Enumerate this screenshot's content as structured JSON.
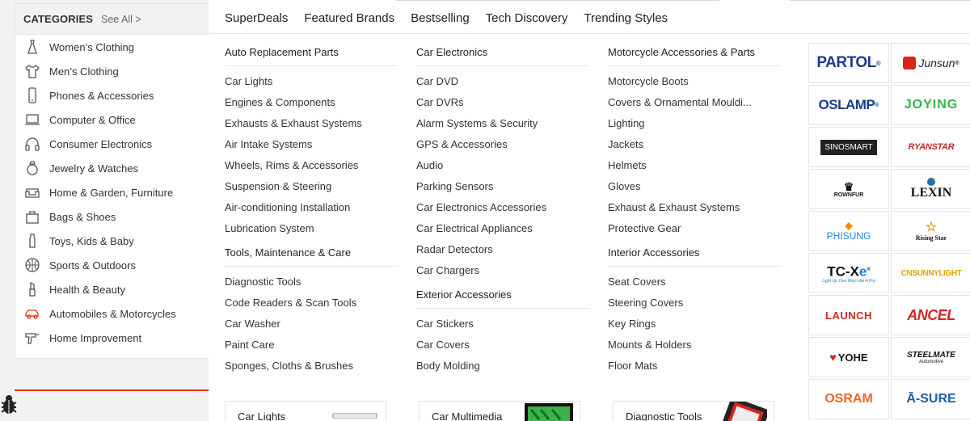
{
  "categories": {
    "title": "CATEGORIES",
    "see_all": "See All >",
    "items": [
      {
        "label": "Women’s Clothing",
        "icon": "dress-icon"
      },
      {
        "label": "Men’s Clothing",
        "icon": "shirt-icon"
      },
      {
        "label": "Phones & Accessories",
        "icon": "phone-icon"
      },
      {
        "label": "Computer & Office",
        "icon": "laptop-icon"
      },
      {
        "label": "Consumer Electronics",
        "icon": "headphones-icon"
      },
      {
        "label": "Jewelry & Watches",
        "icon": "ring-icon"
      },
      {
        "label": "Home & Garden, Furniture",
        "icon": "sofa-icon"
      },
      {
        "label": "Bags & Shoes",
        "icon": "bag-icon"
      },
      {
        "label": "Toys, Kids & Baby",
        "icon": "bottle-icon"
      },
      {
        "label": "Sports & Outdoors",
        "icon": "ball-icon"
      },
      {
        "label": "Health & Beauty",
        "icon": "lipstick-icon"
      },
      {
        "label": "Automobiles & Motorcycles",
        "icon": "car-icon"
      },
      {
        "label": "Home Improvement",
        "icon": "drill-icon"
      }
    ]
  },
  "topnav": [
    "SuperDeals",
    "Featured Brands",
    "Bestselling",
    "Tech Discovery",
    "Trending Styles"
  ],
  "columns": [
    {
      "groups": [
        {
          "heading": "Auto Replacement Parts",
          "links": [
            "Car Lights",
            "Engines & Components",
            "Exhausts & Exhaust Systems",
            "Air Intake Systems",
            "Wheels, Rims & Accessories",
            "Suspension & Steering",
            "Air-conditioning Installation",
            "Lubrication System"
          ]
        },
        {
          "heading": "Tools, Maintenance & Care",
          "links": [
            "Diagnostic Tools",
            "Code Readers & Scan Tools",
            "Car Washer",
            "Paint Care",
            "Sponges, Cloths & Brushes"
          ]
        }
      ]
    },
    {
      "groups": [
        {
          "heading": "Car Electronics",
          "links": [
            "Car DVD",
            "Car DVRs",
            "Alarm Systems & Security",
            "GPS & Accessories",
            "Audio",
            "Parking Sensors",
            "Car Electronics Accessories",
            "Car Electrical Appliances",
            "Radar Detectors",
            "Car Chargers"
          ]
        },
        {
          "heading": "Exterior Accessories",
          "links": [
            "Car Stickers",
            "Car Covers",
            "Body Molding"
          ]
        }
      ]
    },
    {
      "groups": [
        {
          "heading": "Motorcycle Accessories & Parts",
          "links": [
            "Motorcycle Boots",
            "Covers & Ornamental Mouldi...",
            "Lighting",
            "Jackets",
            "Helmets",
            "Gloves",
            "Exhaust & Exhaust Systems",
            "Protective Gear"
          ]
        },
        {
          "heading": "Interior Accessories",
          "links": [
            "Seat Covers",
            "Steering Covers",
            "Key Rings",
            "Mounts & Holders",
            "Floor Mats"
          ]
        }
      ]
    }
  ],
  "brands": [
    {
      "name": "PARTOL",
      "color": "#1b3b8f"
    },
    {
      "name": "Junsun",
      "color": "#222222"
    },
    {
      "name": "OSLAMP",
      "color": "#1b3b8f"
    },
    {
      "name": "JOYING",
      "color": "#36b24a"
    },
    {
      "name": "SINOSMART",
      "color": "#222222"
    },
    {
      "name": "RYANSTAR",
      "color": "#c0282d"
    },
    {
      "name": "ROWNFUR",
      "color": "#111111"
    },
    {
      "name": "LEXIN",
      "color": "#111111"
    },
    {
      "name": "PHISUNG",
      "color": "#1e88e5"
    },
    {
      "name": "Rising Star",
      "color": "#111111"
    },
    {
      "name": "TC-X",
      "color": "#111111"
    },
    {
      "name": "CNSUNNYLIGHT",
      "color": "#e6a000"
    },
    {
      "name": "LAUNCH",
      "color": "#d7261e"
    },
    {
      "name": "ANCEL",
      "color": "#d7261e"
    },
    {
      "name": "YOHE",
      "color": "#111111"
    },
    {
      "name": "STEELMATE",
      "color": "#111111"
    },
    {
      "name": "OSRAM",
      "color": "#f26522"
    },
    {
      "name": "Ā-SURE",
      "color": "#1b5fa8"
    }
  ],
  "brand_extras": {
    "partol_mark": "®",
    "junsun_mark": "®",
    "oslamp_mark": "®",
    "tcx_mark": "®",
    "tcx_tagline": "Light Up Your Way Like A Pro",
    "steelmate_sub": "Automotive"
  },
  "promos": [
    "Car Lights",
    "Car Multimedia",
    "Diagnostic Tools"
  ],
  "colors": {
    "accent": "#e62e04"
  }
}
